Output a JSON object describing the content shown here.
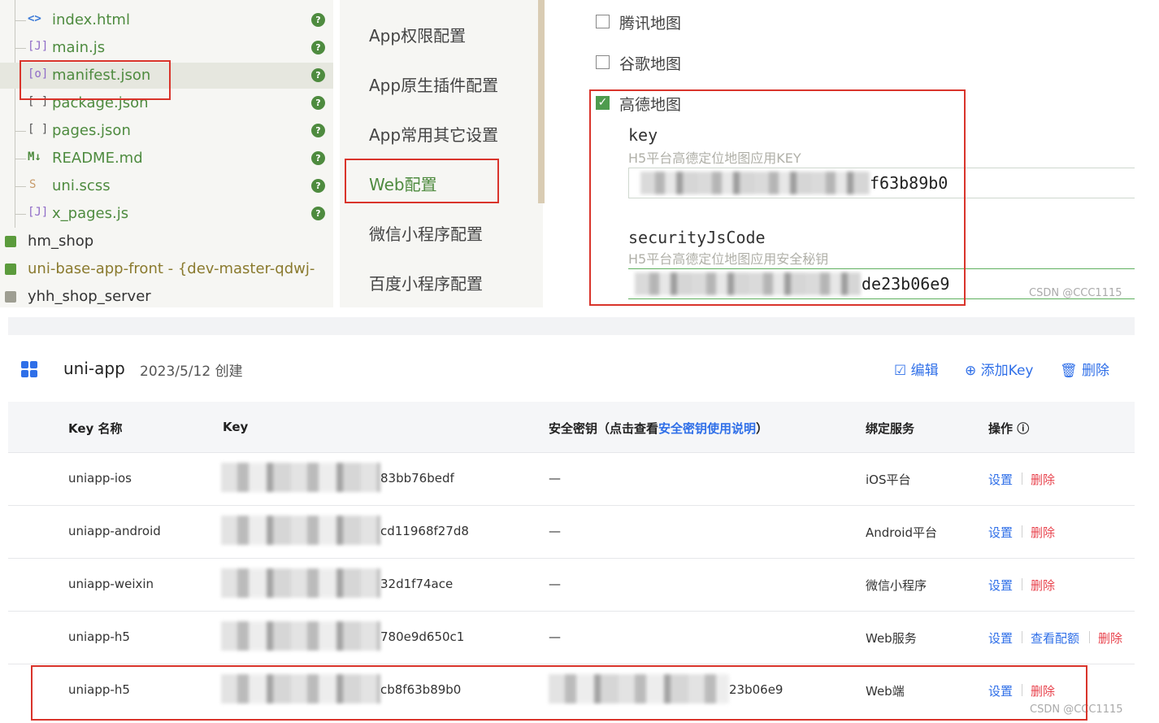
{
  "tree": {
    "items": [
      {
        "icon": "<>",
        "label": "index.html"
      },
      {
        "icon": "[J]",
        "label": "main.js"
      },
      {
        "icon": "[o]",
        "label": "manifest.json"
      },
      {
        "icon": "[ ]",
        "label": "package.json"
      },
      {
        "icon": "[ ]",
        "label": "pages.json"
      },
      {
        "icon": "M↓",
        "label": "README.md"
      },
      {
        "icon": "S",
        "label": "uni.scss"
      },
      {
        "icon": "[J]",
        "label": "x_pages.js"
      }
    ],
    "badge": "?",
    "folders": [
      {
        "label": "hm_shop"
      },
      {
        "label": "uni-base-app-front - {dev-master-qdwj-"
      },
      {
        "label": "yhh_shop_server"
      }
    ]
  },
  "menu": {
    "items": [
      {
        "label": "App权限配置"
      },
      {
        "label": "App原生插件配置"
      },
      {
        "label": "App常用其它设置"
      },
      {
        "label": "Web配置"
      },
      {
        "label": "微信小程序配置"
      },
      {
        "label": "百度小程序配置"
      }
    ]
  },
  "config": {
    "maps": [
      {
        "label": "腾讯地图",
        "checked": false
      },
      {
        "label": "谷歌地图",
        "checked": false
      },
      {
        "label": "高德地图",
        "checked": true
      }
    ],
    "key_label": "key",
    "key_hint": "H5平台高德定位地图应用KEY",
    "key_value_suffix": "f63b89b0",
    "code_label": "securityJsCode",
    "code_hint": "H5平台高德定位地图应用安全秘钥",
    "code_value_suffix": "de23b06e9",
    "watermark": "CSDN @CCC1115"
  },
  "console": {
    "app_name": "uni-app",
    "created": "2023/5/12 创建",
    "actions": {
      "edit": "编辑",
      "add_key": "添加Key",
      "delete": "删除"
    },
    "columns": {
      "key_name": "Key 名称",
      "key": "Key",
      "secret_prefix": "安全密钥（点击查看",
      "secret_link": "安全密钥使用说明",
      "secret_suffix": "）",
      "service": "绑定服务",
      "ops": "操作 ⓘ"
    },
    "rows": [
      {
        "name": "uniapp-ios",
        "key_suffix": "83bb76bedf",
        "secret": "—",
        "service": "iOS平台",
        "ops": [
          "设置",
          "删除"
        ]
      },
      {
        "name": "uniapp-android",
        "key_suffix": "cd11968f27d8",
        "secret": "—",
        "service": "Android平台",
        "ops": [
          "设置",
          "删除"
        ]
      },
      {
        "name": "uniapp-weixin",
        "key_suffix": "32d1f74ace",
        "secret": "—",
        "service": "微信小程序",
        "ops": [
          "设置",
          "删除"
        ]
      },
      {
        "name": "uniapp-h5",
        "key_suffix": "780e9d650c1",
        "secret": "—",
        "service": "Web服务",
        "ops": [
          "设置",
          "查看配额",
          "删除"
        ]
      },
      {
        "name": "uniapp-h5",
        "key_suffix": "cb8f63b89b0",
        "secret": "23b06e9",
        "service": "Web端",
        "ops": [
          "设置",
          "删除"
        ]
      }
    ],
    "watermark": "CSDN @CCC1115"
  },
  "colors": {
    "green": "#4e8b3f",
    "blue": "#2f6fe8",
    "red": "#e8434d",
    "highlight": "#d9342b"
  }
}
